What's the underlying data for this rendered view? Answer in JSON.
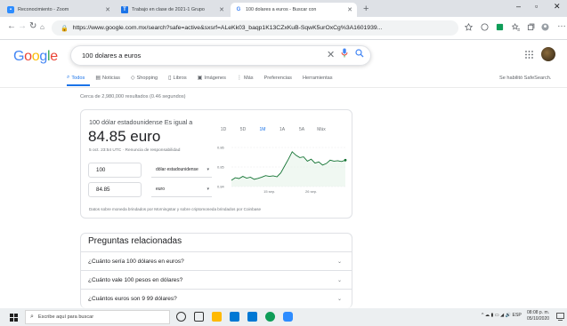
{
  "browser": {
    "tabs": [
      {
        "title": "Reconocimiento - Zoom",
        "favicon_color": "#2d8cff"
      },
      {
        "title": "Trabajo en clase de 2021-1 Grupo",
        "favicon_color": "#1a73e8"
      },
      {
        "title": "100 dolares a euros - Buscar con",
        "favicon_color": "#ffffff"
      }
    ],
    "url": "https://www.google.com.mx/search?safe=active&sxsrf=ALeKk03_baqp1K13CZxKuB-SqwK5urOxCg%3A1601939..."
  },
  "search": {
    "logo": "Google",
    "query": "100 dolares a euros",
    "tabs": [
      "Todos",
      "Noticias",
      "Shopping",
      "Libros",
      "Imágenes",
      "Más",
      "Preferencias",
      "Herramientas"
    ],
    "safesearch": "Se habilitó SafeSearch.",
    "stats": "Cerca de 2,980,000 resultados (0.46 segundos)"
  },
  "converter": {
    "heading": "100 dólar estadounidense Es igual a",
    "result": "84.85 euro",
    "date_note": "5 oct. 23:54 UTC · Renuncia de responsabilidad",
    "from_amount": "100",
    "from_currency": "dólar estadounidense",
    "to_amount": "84.85",
    "to_currency": "euro",
    "footer": "Datos sobre moneda brindados por Morningstar y sobre criptomoneda brindados por Coinbase",
    "ranges": [
      "1D",
      "5D",
      "1M",
      "1A",
      "5A",
      "Máx"
    ],
    "active_range": "1M"
  },
  "chart_data": {
    "type": "line",
    "y_ticks": [
      "0.86",
      "0.85",
      "0.84"
    ],
    "ylim": [
      0.84,
      0.86
    ],
    "x_ticks": [
      "15 sep.",
      "26 sep."
    ],
    "color": "#137333",
    "values": [
      0.8432,
      0.8445,
      0.8441,
      0.8452,
      0.8443,
      0.8448,
      0.8437,
      0.8442,
      0.8448,
      0.8456,
      0.8452,
      0.8455,
      0.845,
      0.847,
      0.8505,
      0.854,
      0.8578,
      0.856,
      0.8548,
      0.8552,
      0.853,
      0.854,
      0.852,
      0.8526,
      0.851,
      0.8518,
      0.8535,
      0.853,
      0.8532,
      0.8528,
      0.8535
    ]
  },
  "related": {
    "title": "Preguntas relacionadas",
    "items": [
      "¿Cuánto sería 100 dólares en euros?",
      "¿Cuánto vale 100 pesos en dólares?",
      "¿Cuántos euros son 9 99 dólares?"
    ]
  },
  "taskbar": {
    "search_placeholder": "Escribe aquí para buscar",
    "lang": "ESP",
    "time": "08:08 p. m.",
    "date": "05/10/2020"
  }
}
